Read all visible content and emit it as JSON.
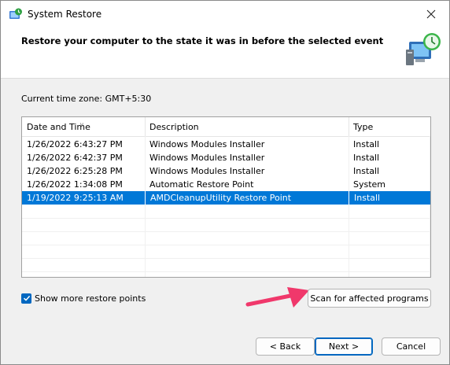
{
  "window": {
    "title": "System Restore",
    "title_icon": "system-restore-icon",
    "close_icon": "close-icon"
  },
  "header": {
    "title": "Restore your computer to the state it was in before the selected event",
    "art_icon": "computer-restore-icon"
  },
  "timezone_label": "Current time zone: GMT+5:30",
  "table": {
    "columns": [
      "Date and Time",
      "Description",
      "Type"
    ],
    "sort_column": "Date and Time",
    "rows": [
      {
        "date": "1/26/2022 6:43:27 PM",
        "description": "Windows Modules Installer",
        "type": "Install",
        "selected": false
      },
      {
        "date": "1/26/2022 6:42:37 PM",
        "description": "Windows Modules Installer",
        "type": "Install",
        "selected": false
      },
      {
        "date": "1/26/2022 6:25:28 PM",
        "description": "Windows Modules Installer",
        "type": "Install",
        "selected": false
      },
      {
        "date": "1/26/2022 1:34:08 PM",
        "description": "Automatic Restore Point",
        "type": "System",
        "selected": false
      },
      {
        "date": "1/19/2022 9:25:13 AM",
        "description": "AMDCleanupUtility Restore Point",
        "type": "Install",
        "selected": true
      }
    ]
  },
  "show_more": {
    "label": "Show more restore points",
    "checked": true
  },
  "buttons": {
    "scan": "Scan for affected programs",
    "back": "< Back",
    "next": "Next >",
    "cancel": "Cancel"
  },
  "annotation": {
    "icon": "pink-arrow-icon",
    "color": "#f0386b"
  },
  "colors": {
    "selection": "#0078d7",
    "accent": "#0067c0"
  }
}
